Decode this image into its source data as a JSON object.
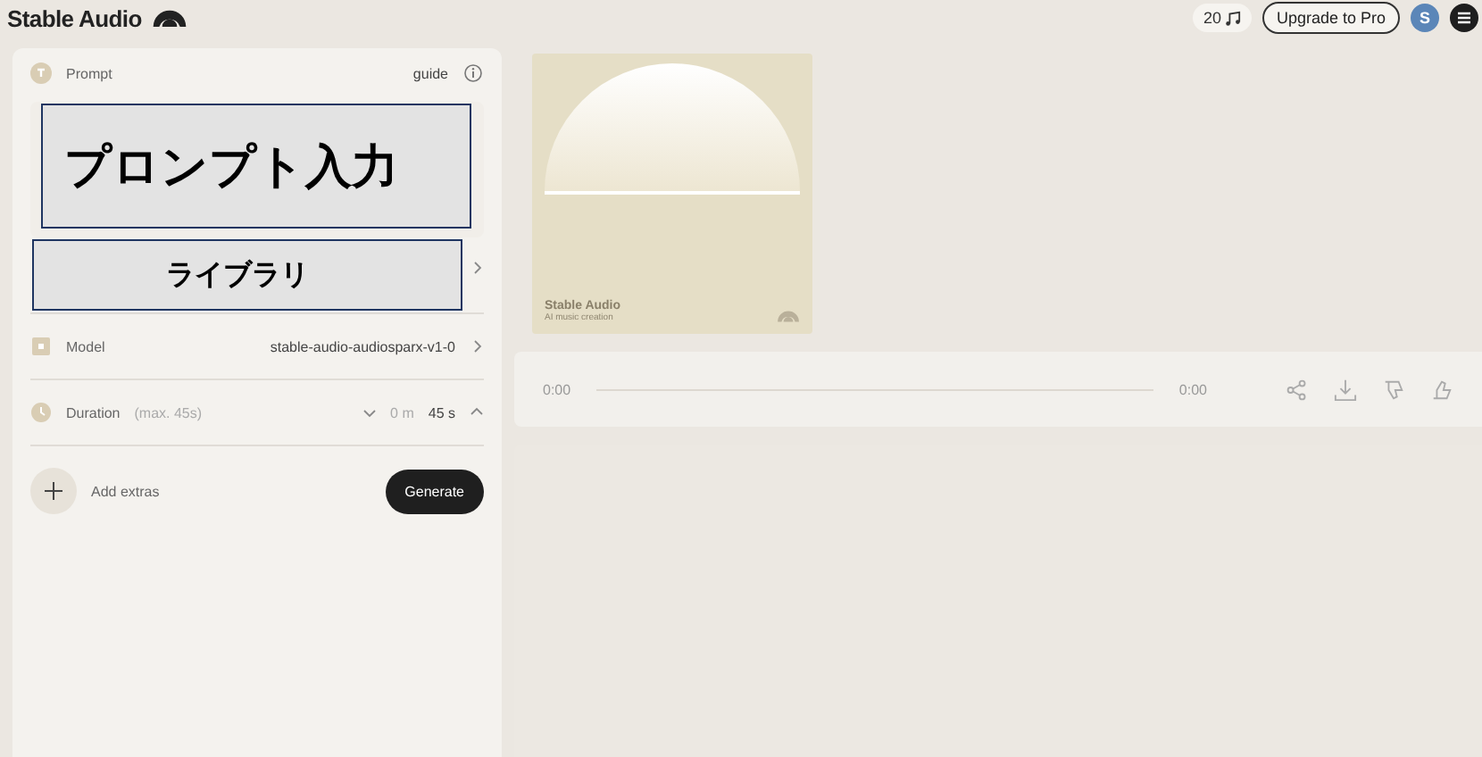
{
  "header": {
    "logo": "Stable Audio",
    "credits": "20",
    "upgrade_button": "Upgrade to Pro",
    "avatar": "S"
  },
  "prompt": {
    "label": "Prompt",
    "guide": "guide"
  },
  "model": {
    "label": "Model",
    "value": "stable-audio-audiosparx-v1-0"
  },
  "duration": {
    "label": "Duration",
    "hint": "(max. 45s)",
    "minutes": "0 m",
    "seconds": "45 s"
  },
  "add_extras": "Add extras",
  "generate_button": "Generate",
  "artwork": {
    "title": "Stable Audio",
    "subtitle": "AI music creation"
  },
  "player": {
    "elapsed": "0:00",
    "total": "0:00"
  },
  "annotations": [
    {
      "text": "プロンプト入力"
    },
    {
      "text": "ライブラリ"
    }
  ]
}
